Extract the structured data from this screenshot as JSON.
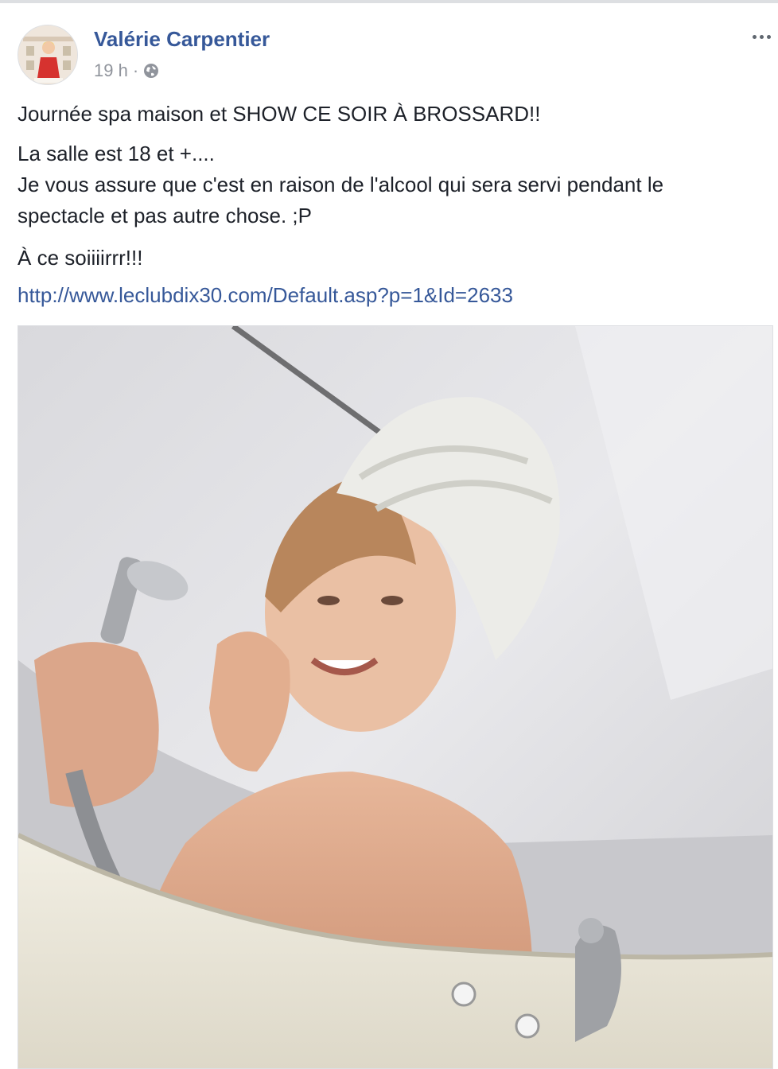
{
  "post": {
    "author": "Valérie Carpentier",
    "timestamp": "19 h",
    "separator": "·",
    "privacy_icon": "globe-icon",
    "more_icon": "more-options-icon",
    "paragraphs": {
      "p1": "Journée spa maison et SHOW CE SOIR À BROSSARD!!",
      "p2_line1": "La salle est 18 et +....",
      "p2_line2": "Je vous assure que c'est en raison de l'alcool qui sera servi pendant le",
      "p2_line3": "spectacle et pas autre chose. ;P",
      "p3": "À ce soiiiirrr!!!"
    },
    "link": "http://www.leclubdix30.com/Default.asp?p=1&Id=2633",
    "photo_icon": "post-photo"
  },
  "colors": {
    "author": "#365899",
    "link": "#365899",
    "meta": "#90949c",
    "text": "#1d2129"
  }
}
